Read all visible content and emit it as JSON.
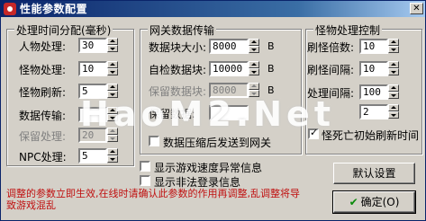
{
  "window": {
    "title": "性能参数配置",
    "close_symbol": "✕"
  },
  "time_group": {
    "legend": "处理时间分配(毫秒)",
    "rows": [
      {
        "label": "人物处理:",
        "value": "30",
        "disabled": false
      },
      {
        "label": "怪物处理:",
        "value": "10",
        "disabled": false
      },
      {
        "label": "怪物刷新:",
        "value": "5",
        "disabled": false
      },
      {
        "label": "数据传输:",
        "value": "",
        "disabled": false
      },
      {
        "label": "保留处理:",
        "value": "20",
        "disabled": true
      },
      {
        "label": "NPC处理:",
        "value": "5",
        "disabled": false
      }
    ]
  },
  "gateway_group": {
    "legend": "网关数据传输",
    "rows": [
      {
        "label": "数据块大小:",
        "value": "8000",
        "unit": "B",
        "disabled": false
      },
      {
        "label": "自检数据块:",
        "value": "10000",
        "unit": "B",
        "disabled": false
      },
      {
        "label": "保留数据块:",
        "value": "8000",
        "unit": "B",
        "disabled": true
      },
      {
        "label": "保留数据:",
        "value": "",
        "unit": "",
        "disabled": false
      }
    ],
    "compress_checkbox": {
      "label": "数据压缩后发送到网关",
      "checked": false
    }
  },
  "monster_group": {
    "legend": "怪物处理控制",
    "rows": [
      {
        "label": "刷怪倍数:",
        "value": "10"
      },
      {
        "label": "刷怪间隔:",
        "value": "10"
      },
      {
        "label": "处理间隔:",
        "value": "100"
      },
      {
        "label": "",
        "value": "2"
      }
    ],
    "dead_checkbox": {
      "label": "怪死亡初始刷新时间",
      "checked": true
    }
  },
  "options": [
    {
      "label": "显示游戏速度异常信息",
      "checked": false
    },
    {
      "label": "显示非法登录信息",
      "checked": false
    }
  ],
  "buttons": {
    "default_label": "默认设置",
    "ok_label": "确定(O)",
    "ok_icon": "check-icon"
  },
  "note": "调整的参数立即生效,在线时请确认此参数的作用再调整,乱调整将导致游戏混乱",
  "watermark": "HaoM2.Net"
}
